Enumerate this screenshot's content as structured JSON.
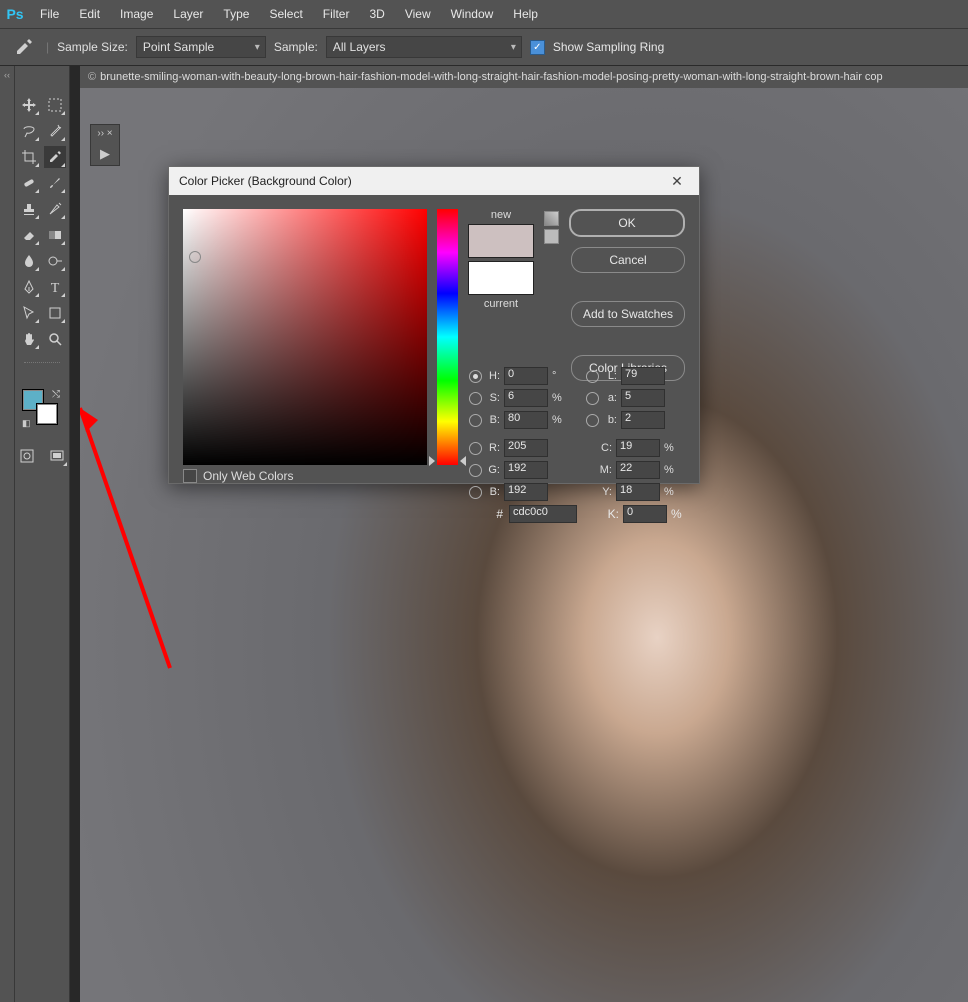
{
  "app": {
    "logo": "Ps"
  },
  "menu": [
    "File",
    "Edit",
    "Image",
    "Layer",
    "Type",
    "Select",
    "Filter",
    "3D",
    "View",
    "Window",
    "Help"
  ],
  "options": {
    "sample_size_label": "Sample Size:",
    "sample_size_value": "Point Sample",
    "sample_label": "Sample:",
    "sample_value": "All Layers",
    "show_ring": "Show Sampling Ring"
  },
  "document": {
    "title": "brunette-smiling-woman-with-beauty-long-brown-hair-fashion-model-with-long-straight-hair-fashion-model-posing-pretty-woman-with-long-straight-brown-hair cop"
  },
  "dialog": {
    "title": "Color Picker (Background Color)",
    "ok": "OK",
    "cancel": "Cancel",
    "add_swatches": "Add to Swatches",
    "color_libraries": "Color Libraries",
    "new_label": "new",
    "current_label": "current",
    "only_web": "Only Web Colors",
    "fields": {
      "H": "0",
      "H_unit": "°",
      "S": "6",
      "S_unit": "%",
      "Bv": "80",
      "Bv_unit": "%",
      "R": "205",
      "G": "192",
      "B": "192",
      "L": "79",
      "a": "5",
      "b": "2",
      "C": "19",
      "M": "22",
      "Y": "18",
      "K": "0",
      "hex": "cdc0c0"
    }
  },
  "swatches": {
    "fg": "#5db0c7",
    "bg": "#ffffff"
  }
}
